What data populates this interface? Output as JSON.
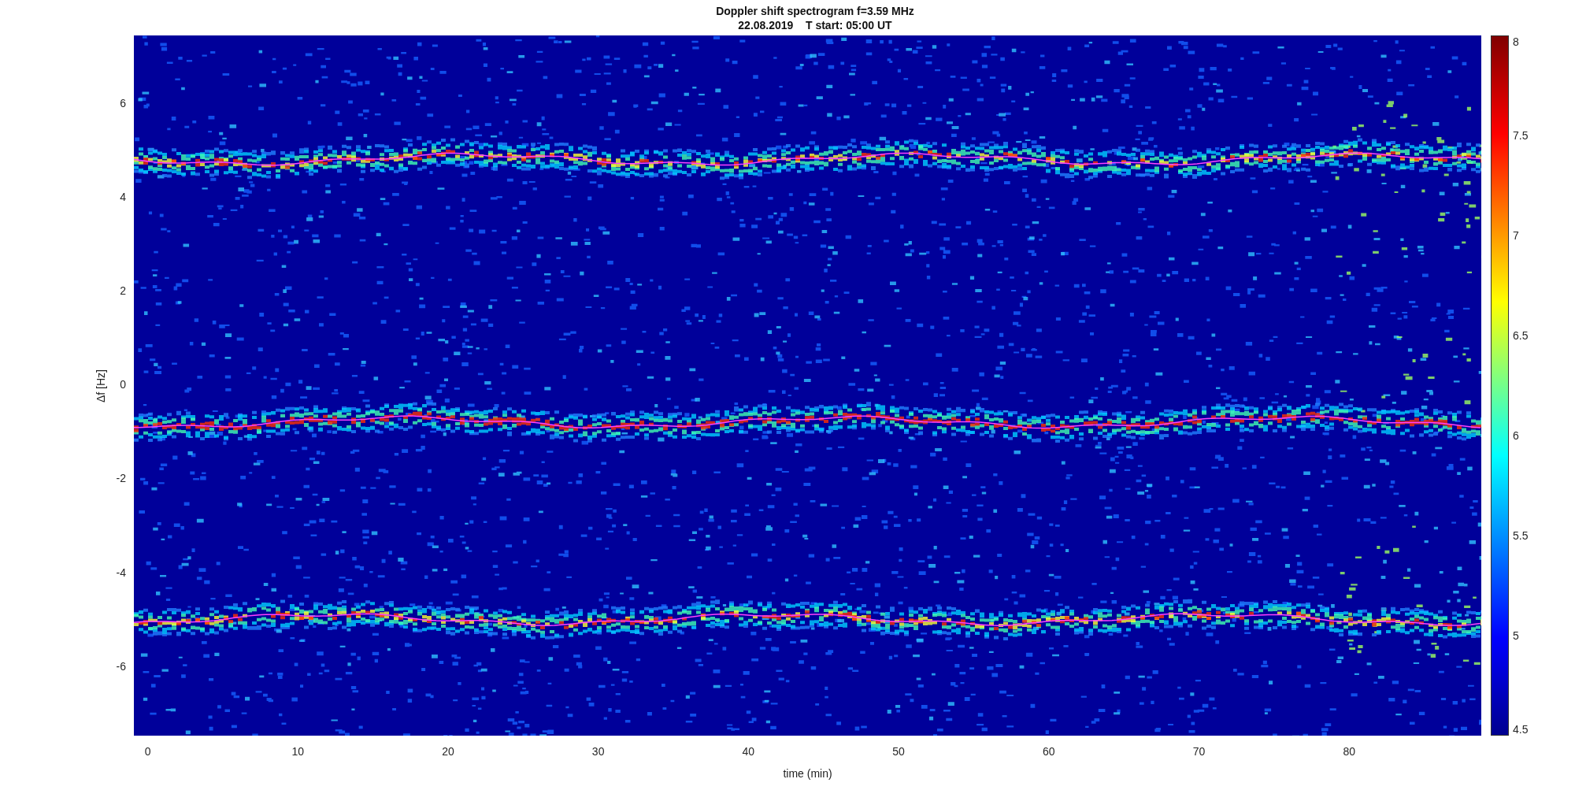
{
  "figure": {
    "title": [
      "Doppler shift spectrogram f=3.59 MHz",
      "22.08.2019    T start: 05:00 UT"
    ],
    "ylabel": "Δf [Hz]",
    "xlabel": "time (min)",
    "yticks": [
      "6",
      "4",
      "2",
      "0",
      "-2",
      "-4",
      "-6"
    ],
    "xticks": [
      "0",
      "10",
      "20",
      "30",
      "40",
      "50",
      "60",
      "70",
      "80"
    ],
    "colorbar_ticks": [
      "8",
      "7.5",
      "7",
      "6.5",
      "6",
      "5.5",
      "5",
      "4.5"
    ]
  }
}
